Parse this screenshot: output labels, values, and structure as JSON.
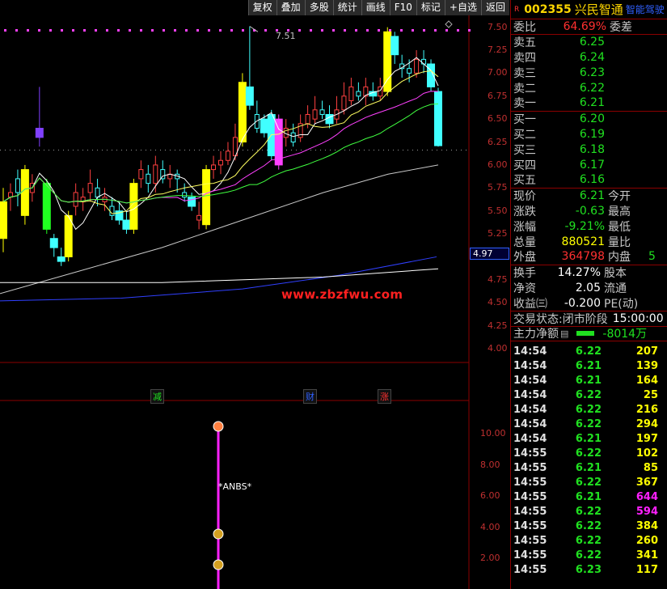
{
  "toolbar": [
    "复权",
    "叠加",
    "多股",
    "统计",
    "画线",
    "F10",
    "标记",
    "+自选",
    "返回"
  ],
  "price_ticks": [
    "7.50",
    "7.25",
    "7.00",
    "6.75",
    "6.50",
    "6.25",
    "6.00",
    "5.75",
    "5.50",
    "5.25",
    "4.75",
    "4.50",
    "4.25",
    "4.00"
  ],
  "indicator_ticks": [
    "10.00",
    "8.00",
    "6.00",
    "4.00",
    "2.00"
  ],
  "current_price_box": "4.97",
  "peak_label": "7.51",
  "watermark": "www.zbzfwu.com",
  "event_tags": [
    {
      "text": "减",
      "color": "#20e020"
    },
    {
      "text": "财",
      "color": "#3060ff"
    },
    {
      "text": "涨",
      "color": "#ff3030"
    }
  ],
  "indicator_label": "*ANBS*",
  "stock": {
    "tag": "R",
    "code": "002355",
    "name": "兴民智通",
    "sub": "智能驾驶"
  },
  "ratio": {
    "label": "委比",
    "value": "64.69%",
    "label2": "委差"
  },
  "asks": [
    {
      "label": "卖五",
      "price": "6.25"
    },
    {
      "label": "卖四",
      "price": "6.24"
    },
    {
      "label": "卖三",
      "price": "6.23"
    },
    {
      "label": "卖二",
      "price": "6.22"
    },
    {
      "label": "卖一",
      "price": "6.21"
    }
  ],
  "bids": [
    {
      "label": "买一",
      "price": "6.20"
    },
    {
      "label": "买二",
      "price": "6.19"
    },
    {
      "label": "买三",
      "price": "6.18"
    },
    {
      "label": "买四",
      "price": "6.17"
    },
    {
      "label": "买五",
      "price": "6.16"
    }
  ],
  "quote": [
    {
      "l": "现价",
      "v": "6.21",
      "vc": "green",
      "r": "今开"
    },
    {
      "l": "涨跌",
      "v": "-0.63",
      "vc": "green",
      "r": "最高"
    },
    {
      "l": "涨幅",
      "v": "-9.21%",
      "vc": "green",
      "r": "最低"
    },
    {
      "l": "总量",
      "v": "880521",
      "vc": "yellow",
      "r": "量比"
    },
    {
      "l": "外盘",
      "v": "364798",
      "vc": "red",
      "r": "内盘",
      "rv": "5"
    }
  ],
  "fund": [
    {
      "l": "换手",
      "v": "14.27%",
      "r": "股本"
    },
    {
      "l": "净资",
      "v": "2.05",
      "r": "流通"
    },
    {
      "l": "收益㈢",
      "v": "-0.200",
      "r": "PE(动)"
    }
  ],
  "trade_status": {
    "label": "交易状态:",
    "status": "闭市阶段",
    "time": "15:00:00"
  },
  "main_flow": {
    "label": "主力净额",
    "value": "-8014万"
  },
  "ticks": [
    {
      "t": "14:54",
      "p": "6.22",
      "v": "207",
      "pc": "green",
      "vc": "yellow"
    },
    {
      "t": "14:54",
      "p": "6.21",
      "v": "139",
      "pc": "green",
      "vc": "yellow"
    },
    {
      "t": "14:54",
      "p": "6.21",
      "v": "164",
      "pc": "green",
      "vc": "yellow"
    },
    {
      "t": "14:54",
      "p": "6.22",
      "v": "25",
      "pc": "green",
      "vc": "yellow"
    },
    {
      "t": "14:54",
      "p": "6.22",
      "v": "216",
      "pc": "green",
      "vc": "yellow"
    },
    {
      "t": "14:54",
      "p": "6.22",
      "v": "294",
      "pc": "green",
      "vc": "yellow"
    },
    {
      "t": "14:54",
      "p": "6.21",
      "v": "197",
      "pc": "green",
      "vc": "yellow"
    },
    {
      "t": "14:55",
      "p": "6.22",
      "v": "102",
      "pc": "green",
      "vc": "yellow"
    },
    {
      "t": "14:55",
      "p": "6.21",
      "v": "85",
      "pc": "green",
      "vc": "yellow"
    },
    {
      "t": "14:55",
      "p": "6.22",
      "v": "367",
      "pc": "green",
      "vc": "yellow"
    },
    {
      "t": "14:55",
      "p": "6.21",
      "v": "644",
      "pc": "green",
      "vc": "magenta"
    },
    {
      "t": "14:55",
      "p": "6.22",
      "v": "594",
      "pc": "green",
      "vc": "magenta"
    },
    {
      "t": "14:55",
      "p": "6.22",
      "v": "384",
      "pc": "green",
      "vc": "yellow"
    },
    {
      "t": "14:55",
      "p": "6.22",
      "v": "260",
      "pc": "green",
      "vc": "yellow"
    },
    {
      "t": "14:55",
      "p": "6.22",
      "v": "341",
      "pc": "green",
      "vc": "yellow"
    },
    {
      "t": "14:55",
      "p": "6.23",
      "v": "117",
      "pc": "green",
      "vc": "yellow"
    }
  ],
  "chart_data": {
    "type": "candlestick",
    "ylim": [
      3.85,
      7.62
    ],
    "candles": [
      {
        "o": 5.2,
        "c": 5.6,
        "h": 5.75,
        "l": 5.05,
        "color": "yellow"
      },
      {
        "o": 5.65,
        "c": 5.7,
        "h": 5.8,
        "l": 5.5,
        "color": "line"
      },
      {
        "o": 5.85,
        "c": 5.7,
        "h": 5.95,
        "l": 5.55,
        "color": "line"
      },
      {
        "o": 5.45,
        "c": 5.95,
        "h": 6.0,
        "l": 5.35,
        "color": "yellow"
      },
      {
        "o": 5.7,
        "c": 5.8,
        "h": 5.9,
        "l": 5.6,
        "color": "line"
      },
      {
        "o": 6.3,
        "c": 6.4,
        "h": 6.85,
        "l": 6.2,
        "color": "purple"
      },
      {
        "o": 5.8,
        "c": 5.3,
        "h": 5.85,
        "l": 5.25,
        "color": "green"
      },
      {
        "o": 5.2,
        "c": 5.1,
        "h": 5.25,
        "l": 5.0,
        "color": "cyan"
      },
      {
        "o": 5.0,
        "c": 4.95,
        "h": 5.1,
        "l": 4.9,
        "color": "cyan"
      },
      {
        "o": 5.0,
        "c": 5.45,
        "h": 5.5,
        "l": 4.95,
        "color": "yellow"
      },
      {
        "o": 5.55,
        "c": 5.7,
        "h": 5.8,
        "l": 5.45,
        "color": "line"
      },
      {
        "o": 5.6,
        "c": 5.65,
        "h": 5.75,
        "l": 5.5,
        "color": "line"
      },
      {
        "o": 5.7,
        "c": 5.8,
        "h": 5.95,
        "l": 5.6,
        "color": "line"
      },
      {
        "o": 5.75,
        "c": 5.65,
        "h": 5.85,
        "l": 5.55,
        "color": "line"
      },
      {
        "o": 5.6,
        "c": 5.65,
        "h": 5.75,
        "l": 5.5,
        "color": "line"
      },
      {
        "o": 5.55,
        "c": 5.45,
        "h": 5.65,
        "l": 5.4,
        "color": "line"
      },
      {
        "o": 5.5,
        "c": 5.4,
        "h": 5.6,
        "l": 5.35,
        "color": "cyan"
      },
      {
        "o": 5.4,
        "c": 5.3,
        "h": 5.5,
        "l": 5.25,
        "color": "cyan"
      },
      {
        "o": 5.3,
        "c": 5.8,
        "h": 5.85,
        "l": 5.25,
        "color": "yellow"
      },
      {
        "o": 5.85,
        "c": 5.95,
        "h": 6.05,
        "l": 5.75,
        "color": "line"
      },
      {
        "o": 5.9,
        "c": 5.8,
        "h": 6.0,
        "l": 5.7,
        "color": "line"
      },
      {
        "o": 5.8,
        "c": 6.0,
        "h": 6.1,
        "l": 5.7,
        "color": "line"
      },
      {
        "o": 5.95,
        "c": 5.85,
        "h": 6.05,
        "l": 5.8,
        "color": "line"
      },
      {
        "o": 5.85,
        "c": 5.9,
        "h": 6.0,
        "l": 5.75,
        "color": "line"
      },
      {
        "o": 5.9,
        "c": 5.85,
        "h": 5.95,
        "l": 5.7,
        "color": "line"
      },
      {
        "o": 5.7,
        "c": 5.65,
        "h": 5.8,
        "l": 5.6,
        "color": "line"
      },
      {
        "o": 5.65,
        "c": 5.55,
        "h": 5.7,
        "l": 5.5,
        "color": "cyan"
      },
      {
        "o": 5.4,
        "c": 5.45,
        "h": 5.6,
        "l": 5.3,
        "color": "line"
      },
      {
        "o": 5.35,
        "c": 5.95,
        "h": 6.0,
        "l": 5.3,
        "color": "yellow"
      },
      {
        "o": 5.95,
        "c": 6.0,
        "h": 6.1,
        "l": 5.85,
        "color": "line"
      },
      {
        "o": 6.0,
        "c": 6.05,
        "h": 6.15,
        "l": 5.9,
        "color": "line"
      },
      {
        "o": 6.05,
        "c": 6.15,
        "h": 6.25,
        "l": 6.0,
        "color": "line"
      },
      {
        "o": 6.1,
        "c": 6.3,
        "h": 6.45,
        "l": 6.05,
        "color": "line"
      },
      {
        "o": 6.25,
        "c": 6.9,
        "h": 7.0,
        "l": 6.2,
        "color": "yellow"
      },
      {
        "o": 6.85,
        "c": 6.65,
        "h": 7.51,
        "l": 6.6,
        "color": "cyan"
      },
      {
        "o": 6.55,
        "c": 6.4,
        "h": 6.7,
        "l": 6.35,
        "color": "line"
      },
      {
        "o": 6.5,
        "c": 6.35,
        "h": 6.55,
        "l": 6.3,
        "color": "cyan"
      },
      {
        "o": 6.1,
        "c": 6.55,
        "h": 6.6,
        "l": 6.05,
        "color": "cyan"
      },
      {
        "o": 6.5,
        "c": 6.0,
        "h": 6.55,
        "l": 5.95,
        "color": "pink"
      },
      {
        "o": 6.3,
        "c": 6.4,
        "h": 6.5,
        "l": 6.2,
        "color": "line"
      },
      {
        "o": 6.35,
        "c": 6.25,
        "h": 6.45,
        "l": 6.2,
        "color": "line"
      },
      {
        "o": 6.3,
        "c": 6.45,
        "h": 6.55,
        "l": 6.25,
        "color": "line"
      },
      {
        "o": 6.45,
        "c": 6.55,
        "h": 6.65,
        "l": 6.4,
        "color": "line"
      },
      {
        "o": 6.5,
        "c": 6.6,
        "h": 6.75,
        "l": 6.45,
        "color": "line"
      },
      {
        "o": 6.6,
        "c": 6.55,
        "h": 6.7,
        "l": 6.5,
        "color": "line"
      },
      {
        "o": 6.55,
        "c": 6.45,
        "h": 6.65,
        "l": 6.4,
        "color": "cyan"
      },
      {
        "o": 6.5,
        "c": 6.6,
        "h": 6.75,
        "l": 6.45,
        "color": "line"
      },
      {
        "o": 6.6,
        "c": 6.75,
        "h": 6.9,
        "l": 6.55,
        "color": "line"
      },
      {
        "o": 6.7,
        "c": 6.85,
        "h": 6.95,
        "l": 6.65,
        "color": "line"
      },
      {
        "o": 6.8,
        "c": 6.75,
        "h": 6.9,
        "l": 6.7,
        "color": "line"
      },
      {
        "o": 6.75,
        "c": 6.85,
        "h": 6.95,
        "l": 6.65,
        "color": "line"
      },
      {
        "o": 6.8,
        "c": 6.75,
        "h": 6.9,
        "l": 6.7,
        "color": "cyan"
      },
      {
        "o": 6.75,
        "c": 6.85,
        "h": 6.95,
        "l": 6.7,
        "color": "line"
      },
      {
        "o": 6.8,
        "c": 7.45,
        "h": 7.5,
        "l": 6.75,
        "color": "yellow"
      },
      {
        "o": 7.4,
        "c": 7.2,
        "h": 7.45,
        "l": 7.1,
        "color": "cyan"
      },
      {
        "o": 7.1,
        "c": 7.05,
        "h": 7.2,
        "l": 6.95,
        "color": "line"
      },
      {
        "o": 7.05,
        "c": 7.0,
        "h": 7.15,
        "l": 6.9,
        "color": "line"
      },
      {
        "o": 7.0,
        "c": 7.15,
        "h": 7.25,
        "l": 6.95,
        "color": "line"
      },
      {
        "o": 7.15,
        "c": 7.1,
        "h": 7.25,
        "l": 7.0,
        "color": "line"
      },
      {
        "o": 7.1,
        "c": 6.85,
        "h": 7.15,
        "l": 6.8,
        "color": "cyan"
      },
      {
        "o": 6.8,
        "c": 6.21,
        "h": 6.84,
        "l": 6.2,
        "color": "cyan"
      }
    ]
  }
}
